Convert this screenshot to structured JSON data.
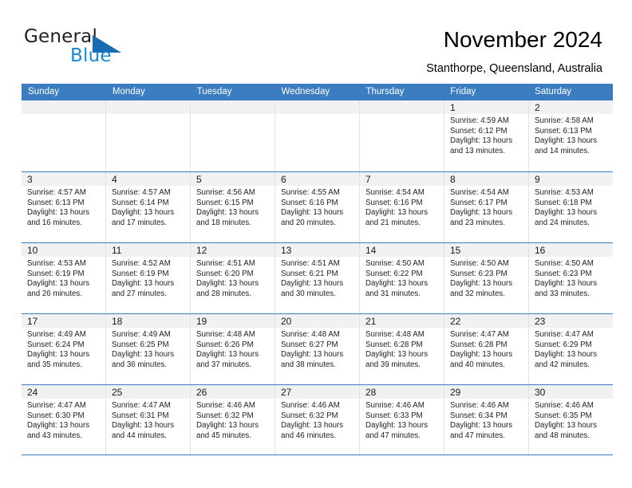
{
  "brand": {
    "name_part1": "General",
    "name_part2": "Blue",
    "triangle_color": "#1a6cb0",
    "blue_text_color": "#1787d8"
  },
  "header": {
    "title": "November 2024",
    "subtitle": "Stanthorpe, Queensland, Australia"
  },
  "theme": {
    "header_blue": "#3b7dc0",
    "daynum_band": "#f1f1f1",
    "cell_border": "#e2e2e2"
  },
  "calendar": {
    "weekday_headers": [
      "Sunday",
      "Monday",
      "Tuesday",
      "Wednesday",
      "Thursday",
      "Friday",
      "Saturday"
    ],
    "weeks": [
      [
        {
          "day": "",
          "lines": []
        },
        {
          "day": "",
          "lines": []
        },
        {
          "day": "",
          "lines": []
        },
        {
          "day": "",
          "lines": []
        },
        {
          "day": "",
          "lines": []
        },
        {
          "day": "1",
          "lines": [
            "Sunrise: 4:59 AM",
            "Sunset: 6:12 PM",
            "Daylight: 13 hours",
            "and 13 minutes."
          ]
        },
        {
          "day": "2",
          "lines": [
            "Sunrise: 4:58 AM",
            "Sunset: 6:13 PM",
            "Daylight: 13 hours",
            "and 14 minutes."
          ]
        }
      ],
      [
        {
          "day": "3",
          "lines": [
            "Sunrise: 4:57 AM",
            "Sunset: 6:13 PM",
            "Daylight: 13 hours",
            "and 16 minutes."
          ]
        },
        {
          "day": "4",
          "lines": [
            "Sunrise: 4:57 AM",
            "Sunset: 6:14 PM",
            "Daylight: 13 hours",
            "and 17 minutes."
          ]
        },
        {
          "day": "5",
          "lines": [
            "Sunrise: 4:56 AM",
            "Sunset: 6:15 PM",
            "Daylight: 13 hours",
            "and 18 minutes."
          ]
        },
        {
          "day": "6",
          "lines": [
            "Sunrise: 4:55 AM",
            "Sunset: 6:16 PM",
            "Daylight: 13 hours",
            "and 20 minutes."
          ]
        },
        {
          "day": "7",
          "lines": [
            "Sunrise: 4:54 AM",
            "Sunset: 6:16 PM",
            "Daylight: 13 hours",
            "and 21 minutes."
          ]
        },
        {
          "day": "8",
          "lines": [
            "Sunrise: 4:54 AM",
            "Sunset: 6:17 PM",
            "Daylight: 13 hours",
            "and 23 minutes."
          ]
        },
        {
          "day": "9",
          "lines": [
            "Sunrise: 4:53 AM",
            "Sunset: 6:18 PM",
            "Daylight: 13 hours",
            "and 24 minutes."
          ]
        }
      ],
      [
        {
          "day": "10",
          "lines": [
            "Sunrise: 4:53 AM",
            "Sunset: 6:19 PM",
            "Daylight: 13 hours",
            "and 26 minutes."
          ]
        },
        {
          "day": "11",
          "lines": [
            "Sunrise: 4:52 AM",
            "Sunset: 6:19 PM",
            "Daylight: 13 hours",
            "and 27 minutes."
          ]
        },
        {
          "day": "12",
          "lines": [
            "Sunrise: 4:51 AM",
            "Sunset: 6:20 PM",
            "Daylight: 13 hours",
            "and 28 minutes."
          ]
        },
        {
          "day": "13",
          "lines": [
            "Sunrise: 4:51 AM",
            "Sunset: 6:21 PM",
            "Daylight: 13 hours",
            "and 30 minutes."
          ]
        },
        {
          "day": "14",
          "lines": [
            "Sunrise: 4:50 AM",
            "Sunset: 6:22 PM",
            "Daylight: 13 hours",
            "and 31 minutes."
          ]
        },
        {
          "day": "15",
          "lines": [
            "Sunrise: 4:50 AM",
            "Sunset: 6:23 PM",
            "Daylight: 13 hours",
            "and 32 minutes."
          ]
        },
        {
          "day": "16",
          "lines": [
            "Sunrise: 4:50 AM",
            "Sunset: 6:23 PM",
            "Daylight: 13 hours",
            "and 33 minutes."
          ]
        }
      ],
      [
        {
          "day": "17",
          "lines": [
            "Sunrise: 4:49 AM",
            "Sunset: 6:24 PM",
            "Daylight: 13 hours",
            "and 35 minutes."
          ]
        },
        {
          "day": "18",
          "lines": [
            "Sunrise: 4:49 AM",
            "Sunset: 6:25 PM",
            "Daylight: 13 hours",
            "and 36 minutes."
          ]
        },
        {
          "day": "19",
          "lines": [
            "Sunrise: 4:48 AM",
            "Sunset: 6:26 PM",
            "Daylight: 13 hours",
            "and 37 minutes."
          ]
        },
        {
          "day": "20",
          "lines": [
            "Sunrise: 4:48 AM",
            "Sunset: 6:27 PM",
            "Daylight: 13 hours",
            "and 38 minutes."
          ]
        },
        {
          "day": "21",
          "lines": [
            "Sunrise: 4:48 AM",
            "Sunset: 6:28 PM",
            "Daylight: 13 hours",
            "and 39 minutes."
          ]
        },
        {
          "day": "22",
          "lines": [
            "Sunrise: 4:47 AM",
            "Sunset: 6:28 PM",
            "Daylight: 13 hours",
            "and 40 minutes."
          ]
        },
        {
          "day": "23",
          "lines": [
            "Sunrise: 4:47 AM",
            "Sunset: 6:29 PM",
            "Daylight: 13 hours",
            "and 42 minutes."
          ]
        }
      ],
      [
        {
          "day": "24",
          "lines": [
            "Sunrise: 4:47 AM",
            "Sunset: 6:30 PM",
            "Daylight: 13 hours",
            "and 43 minutes."
          ]
        },
        {
          "day": "25",
          "lines": [
            "Sunrise: 4:47 AM",
            "Sunset: 6:31 PM",
            "Daylight: 13 hours",
            "and 44 minutes."
          ]
        },
        {
          "day": "26",
          "lines": [
            "Sunrise: 4:46 AM",
            "Sunset: 6:32 PM",
            "Daylight: 13 hours",
            "and 45 minutes."
          ]
        },
        {
          "day": "27",
          "lines": [
            "Sunrise: 4:46 AM",
            "Sunset: 6:32 PM",
            "Daylight: 13 hours",
            "and 46 minutes."
          ]
        },
        {
          "day": "28",
          "lines": [
            "Sunrise: 4:46 AM",
            "Sunset: 6:33 PM",
            "Daylight: 13 hours",
            "and 47 minutes."
          ]
        },
        {
          "day": "29",
          "lines": [
            "Sunrise: 4:46 AM",
            "Sunset: 6:34 PM",
            "Daylight: 13 hours",
            "and 47 minutes."
          ]
        },
        {
          "day": "30",
          "lines": [
            "Sunrise: 4:46 AM",
            "Sunset: 6:35 PM",
            "Daylight: 13 hours",
            "and 48 minutes."
          ]
        }
      ]
    ]
  }
}
